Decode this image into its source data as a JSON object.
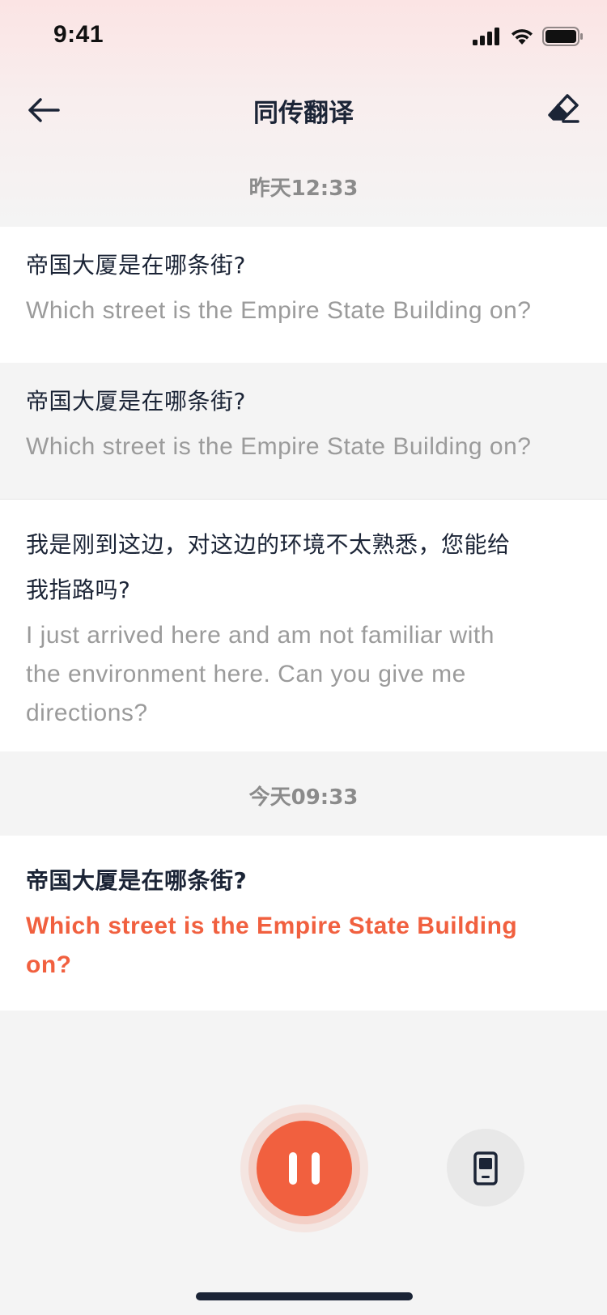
{
  "status_bar": {
    "time": "9:41"
  },
  "nav": {
    "title": "同传翻译"
  },
  "timestamps": {
    "yesterday": "昨天12:33",
    "today": "今天09:33"
  },
  "messages": [
    {
      "source": "帝国大厦是在哪条街?",
      "translation": "Which street is the Empire State Building on?"
    },
    {
      "source": "帝国大厦是在哪条街?",
      "translation": "Which street is the Empire State Building on?"
    },
    {
      "source_line1": "我是刚到这边，对这边的环境不太熟悉，您能给",
      "source_line2": "我指路吗?",
      "translation_line1": "I just arrived here and am not familiar with",
      "translation_line2": "the environment here. Can you give me",
      "translation_line3": "directions?"
    },
    {
      "source": "帝国大厦是在哪条街?",
      "translation_line1": "Which street is the Empire State Building",
      "translation_line2": "on?"
    }
  ],
  "colors": {
    "accent": "#f1603f",
    "text_primary": "#1b2436",
    "text_secondary": "#9b9b9b"
  },
  "icons": {
    "back": "arrow-left-icon",
    "erase": "eraser-icon",
    "pause": "pause-icon",
    "device": "phone-device-icon"
  }
}
